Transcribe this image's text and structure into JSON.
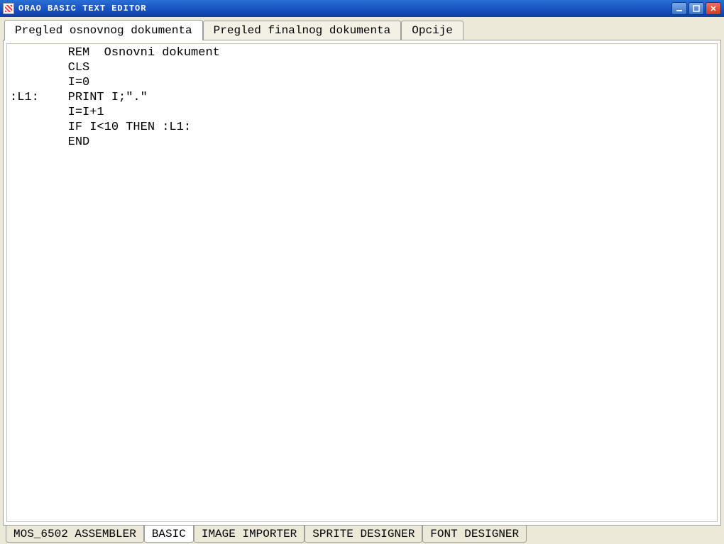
{
  "window": {
    "title": "ORAO  BASIC  TEXT  EDITOR"
  },
  "top_tabs": [
    {
      "label": "Pregled osnovnog dokumenta",
      "active": true
    },
    {
      "label": "Pregled finalnog dokumenta",
      "active": false
    },
    {
      "label": "Opcije",
      "active": false
    }
  ],
  "editor": {
    "content": "        REM  Osnovni dokument\n        CLS\n        I=0\n:L1:    PRINT I;\".\"\n        I=I+1\n        IF I<10 THEN :L1:\n        END"
  },
  "bottom_tabs": [
    {
      "label": " MOS_6502 ASSEMBLER ",
      "active": false
    },
    {
      "label": "  BASIC   ",
      "active": true
    },
    {
      "label": " IMAGE IMPORTER ",
      "active": false
    },
    {
      "label": "SPRITE DESIGNER",
      "active": false
    },
    {
      "label": "FONT DESIGNER",
      "active": false
    }
  ]
}
